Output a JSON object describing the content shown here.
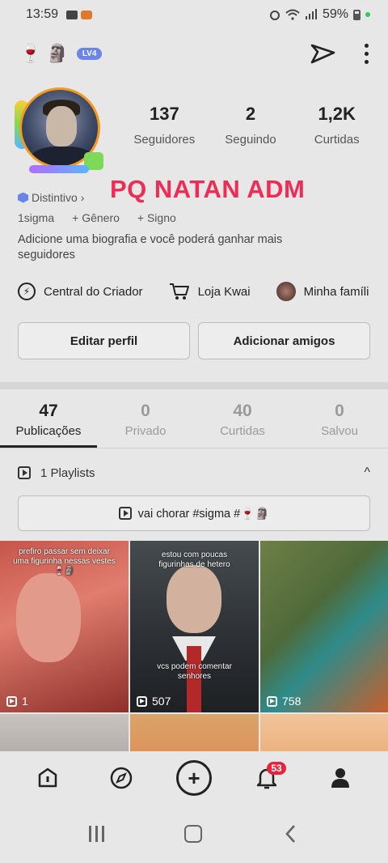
{
  "status_bar": {
    "time": "13:59",
    "battery": "59%"
  },
  "profile": {
    "level_badge": "LV4",
    "followers_count": "137",
    "followers_label": "Seguidores",
    "following_count": "2",
    "following_label": "Seguindo",
    "likes_count": "1,2K",
    "likes_label": "Curtidas",
    "overlay_text": "PQ NATAN ADM",
    "distintivo_label": "Distintivo",
    "distintivo_chevron": "›",
    "username": "1sigma",
    "gender_label": "+ Gênero",
    "sign_label": "+ Signo",
    "bio_placeholder": "Adicione uma biografia e você poderá ganhar mais seguidores"
  },
  "shortcuts": [
    {
      "label": "Central do Criador",
      "icon": "lightning-icon"
    },
    {
      "label": "Loja Kwai",
      "icon": "cart-icon"
    },
    {
      "label": "Minha famíli",
      "icon": "family-avatar-icon"
    }
  ],
  "buttons": {
    "edit_profile": "Editar perfil",
    "add_friends": "Adicionar amigos"
  },
  "tabs": [
    {
      "count": "47",
      "label": "Publicações",
      "active": true
    },
    {
      "count": "0",
      "label": "Privado",
      "active": false
    },
    {
      "count": "40",
      "label": "Curtidas",
      "active": false
    },
    {
      "count": "0",
      "label": "Salvou",
      "active": false
    }
  ],
  "playlist": {
    "header": "1 Playlists",
    "collapse_glyph": "^",
    "item_title": "vai chorar #sigma #🍷🗿"
  },
  "videos": [
    {
      "caption": "prefiro passar sem deixar uma figurinha nessas vestes🍷🗿",
      "views": "1"
    },
    {
      "caption_top": "estou com poucas figurinhas de hetero",
      "caption_bottom": "vcs podem comentar senhores",
      "views": "507"
    },
    {
      "caption": "",
      "views": "758"
    }
  ],
  "bottom_nav": {
    "notification_count": "53"
  },
  "colors": {
    "overlay_red": "#ef2c56",
    "badge_red": "#e8243c",
    "level_blue": "#6b84e8"
  }
}
